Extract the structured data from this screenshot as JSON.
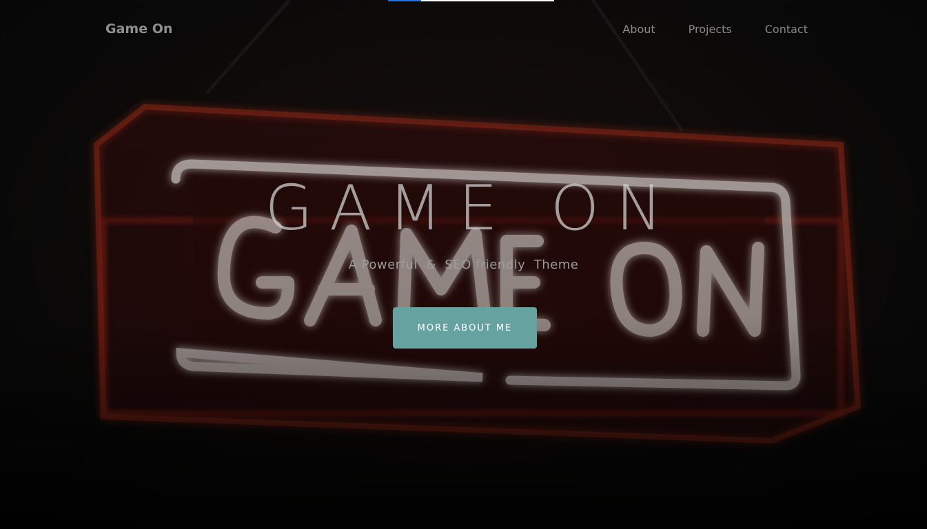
{
  "nav": {
    "brand": "Game On",
    "links": [
      "About",
      "Projects",
      "Contact"
    ]
  },
  "hero": {
    "title": "GAME ON",
    "subtitle": "A Powerful  &  SEO friendly  Theme",
    "cta_label": "MORE ABOUT ME"
  },
  "scroll_progress": 0.2,
  "colors": {
    "cta_background": "#66a3a0",
    "progress_fill": "#1a73e8",
    "progress_track": "#ffffff",
    "neon_tube": "#e6dcd8",
    "neon_glow": "#c2281a"
  }
}
